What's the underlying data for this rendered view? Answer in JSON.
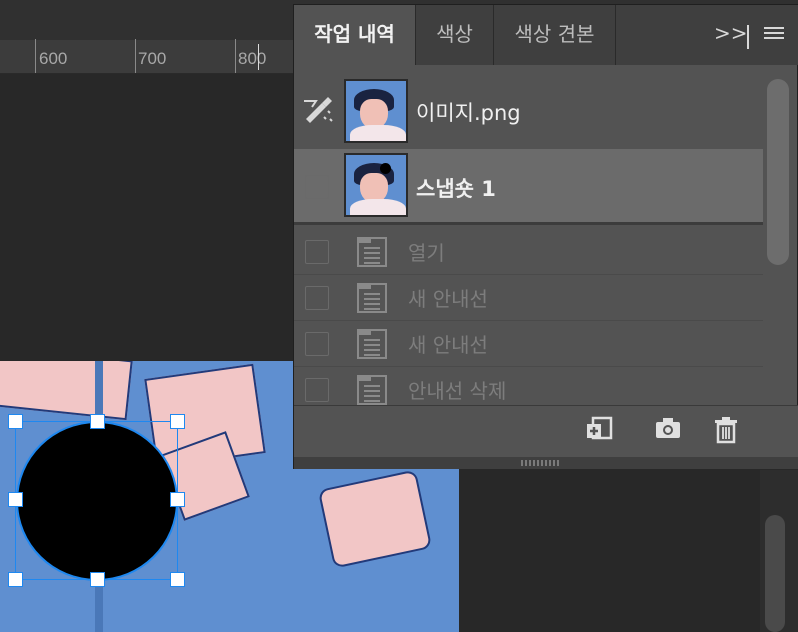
{
  "ruler": {
    "labels": [
      "600",
      "700",
      "800"
    ]
  },
  "panel": {
    "tabs": [
      {
        "label": "작업 내역",
        "active": true
      },
      {
        "label": "색상",
        "active": false
      },
      {
        "label": "색상 견본",
        "active": false
      }
    ],
    "collapse_label": ">>",
    "snapshots": [
      {
        "label": "이미지.png",
        "history_brush": true
      },
      {
        "label": "스냅숏 1",
        "selected": true
      }
    ],
    "states": [
      {
        "label": "열기"
      },
      {
        "label": "새 안내선"
      },
      {
        "label": "새 안내선"
      },
      {
        "label": "안내선 삭제"
      }
    ],
    "footer_icons": [
      "new-document-from-state-icon",
      "camera-icon",
      "trash-icon"
    ]
  },
  "canvas": {
    "shape_fill": "#000000",
    "selection_color": "#1e88f0"
  }
}
